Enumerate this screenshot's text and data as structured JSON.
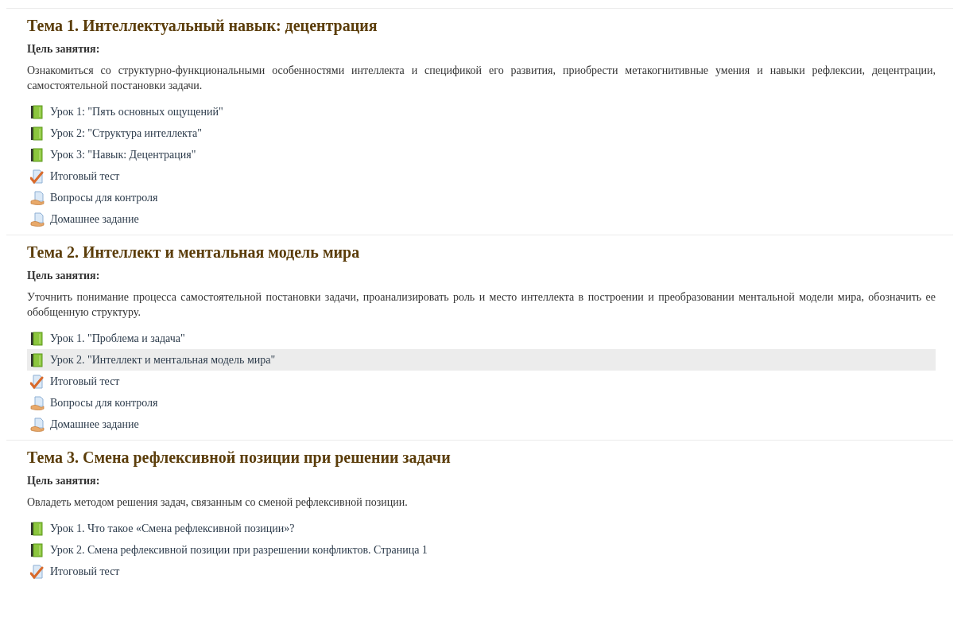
{
  "sections": [
    {
      "title": "Тема 1. Интеллектуальный навык: децентрация",
      "goal_label": "Цель занятия:",
      "goal_text": "Ознакомиться со структурно-функциональными особенностями интеллекта и спецификой его развития, приобрести метакогнитивные умения и навыки рефлексии, децентрации, самостоятельной постановки задачи.",
      "items": [
        {
          "kind": "book",
          "label": "Урок 1: \"Пять основных ощущений\"",
          "selected": false
        },
        {
          "kind": "book",
          "label": "Урок 2: \"Структура интеллекта\"",
          "selected": false
        },
        {
          "kind": "book",
          "label": "Урок 3: \"Навык: Децентрация\"",
          "selected": false
        },
        {
          "kind": "quiz",
          "label": "Итоговый тест",
          "selected": false
        },
        {
          "kind": "assignment",
          "label": "Вопросы для контроля",
          "selected": false
        },
        {
          "kind": "assignment",
          "label": "Домашнее задание",
          "selected": false
        }
      ]
    },
    {
      "title": "Тема 2. Интеллект и ментальная модель мира",
      "goal_label": "Цель занятия:",
      "goal_text": "Уточнить понимание процесса самостоятельной постановки задачи, проанализировать роль и место интеллекта в построении и преобразовании ментальной модели мира, обозначить ее обобщенную структуру.",
      "items": [
        {
          "kind": "book",
          "label": "Урок 1. \"Проблема и задача\"",
          "selected": false
        },
        {
          "kind": "book",
          "label": "Урок 2. \"Интеллект и ментальная модель мира\"",
          "selected": true
        },
        {
          "kind": "quiz",
          "label": "Итоговый тест",
          "selected": false
        },
        {
          "kind": "assignment",
          "label": "Вопросы для контроля",
          "selected": false
        },
        {
          "kind": "assignment",
          "label": "Домашнее задание",
          "selected": false
        }
      ]
    },
    {
      "title": "Тема 3. Смена рефлексивной позиции при решении задачи",
      "goal_label": "Цель занятия:",
      "goal_text": "Овладеть методом решения задач, связанным со сменой рефлексивной позиции.",
      "items": [
        {
          "kind": "book",
          "label": "Урок 1. Что такое «Смена рефлексивной позиции»?",
          "selected": false
        },
        {
          "kind": "book",
          "label": "Урок 2. Смена рефлексивной позиции при разрешении конфликтов. Страница 1",
          "selected": false
        },
        {
          "kind": "quiz",
          "label": "Итоговый тест",
          "selected": false
        }
      ]
    }
  ]
}
